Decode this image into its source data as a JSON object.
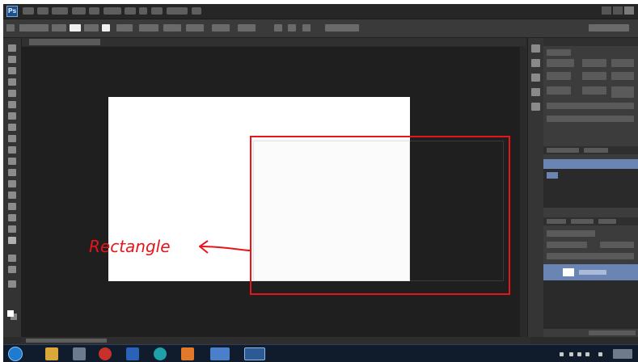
{
  "annotation": {
    "label": "Rectangle",
    "color": "#e8141b"
  },
  "canvas": {
    "background": "#ffffff"
  },
  "icons": {
    "app": "photoshop-icon",
    "taskbar": [
      "start-orb-icon",
      "folder-icon",
      "media-icon",
      "app-icon",
      "mail-icon",
      "browser-icon",
      "notes-icon",
      "image-icon",
      "photoshop-icon"
    ]
  },
  "colors": {
    "workspace": "#2b2b2b",
    "taskbar": "#101b2b"
  }
}
